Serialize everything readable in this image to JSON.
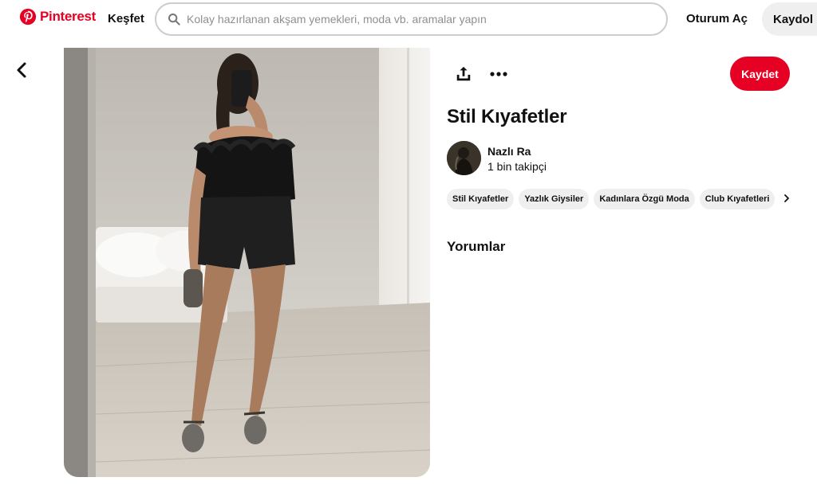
{
  "header": {
    "logo_text": "Pinterest",
    "explore_label": "Keşfet",
    "search_placeholder": "Kolay hazırlanan akşam yemekleri, moda vb. aramalar yapın",
    "login_label": "Oturum Aç",
    "signup_label": "Kaydol"
  },
  "pin": {
    "save_label": "Kaydet",
    "title": "Stil Kıyafetler",
    "author": {
      "name": "Nazlı Ra",
      "followers": "1 bin takipçi"
    },
    "tags": [
      "Stil Kıyafetler",
      "Yazlık Giysiler",
      "Kadınlara Özgü Moda",
      "Club Kıyafetleri"
    ],
    "comments_heading": "Yorumlar"
  },
  "icons": {
    "back": "chevron-left-icon",
    "search": "search-icon",
    "share": "share-icon",
    "more": "more-icon",
    "tags_next": "chevron-right-icon"
  },
  "colors": {
    "brand": "#e60023",
    "chip": "#efefef",
    "text": "#111111"
  }
}
